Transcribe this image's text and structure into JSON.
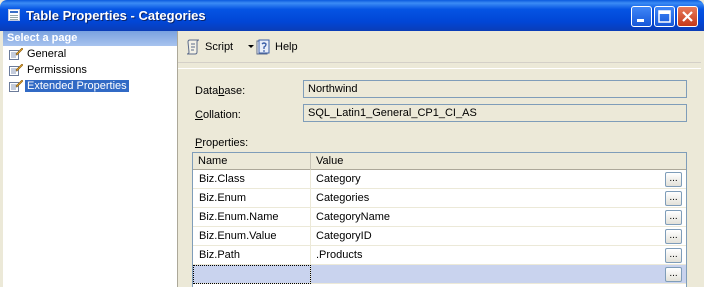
{
  "window": {
    "title": "Table Properties - Categories"
  },
  "left_pane": {
    "header": "Select a page",
    "pages": [
      {
        "label": "General",
        "selected": false
      },
      {
        "label": "Permissions",
        "selected": false
      },
      {
        "label": "Extended Properties",
        "selected": true
      }
    ]
  },
  "toolbar": {
    "script_label": "Script",
    "help_label": "Help"
  },
  "fields": {
    "database_label_pre": "Data",
    "database_label_ul": "b",
    "database_label_post": "ase:",
    "database_value": "Northwind",
    "collation_label_ul": "C",
    "collation_label_post": "ollation:",
    "collation_value": "SQL_Latin1_General_CP1_CI_AS"
  },
  "properties": {
    "label_ul": "P",
    "label_post": "roperties:",
    "columns": [
      "Name",
      "Value"
    ],
    "rows": [
      {
        "name": "Biz.Class",
        "value": "Category",
        "button": "..."
      },
      {
        "name": "Biz.Enum",
        "value": "Categories",
        "button": "..."
      },
      {
        "name": "Biz.Enum.Name",
        "value": "CategoryName",
        "button": "..."
      },
      {
        "name": "Biz.Enum.Value",
        "value": "CategoryID",
        "button": "..."
      },
      {
        "name": "Biz.Path",
        "value": ".Products",
        "button": "..."
      },
      {
        "name": "",
        "value": "",
        "button": "..."
      }
    ]
  }
}
